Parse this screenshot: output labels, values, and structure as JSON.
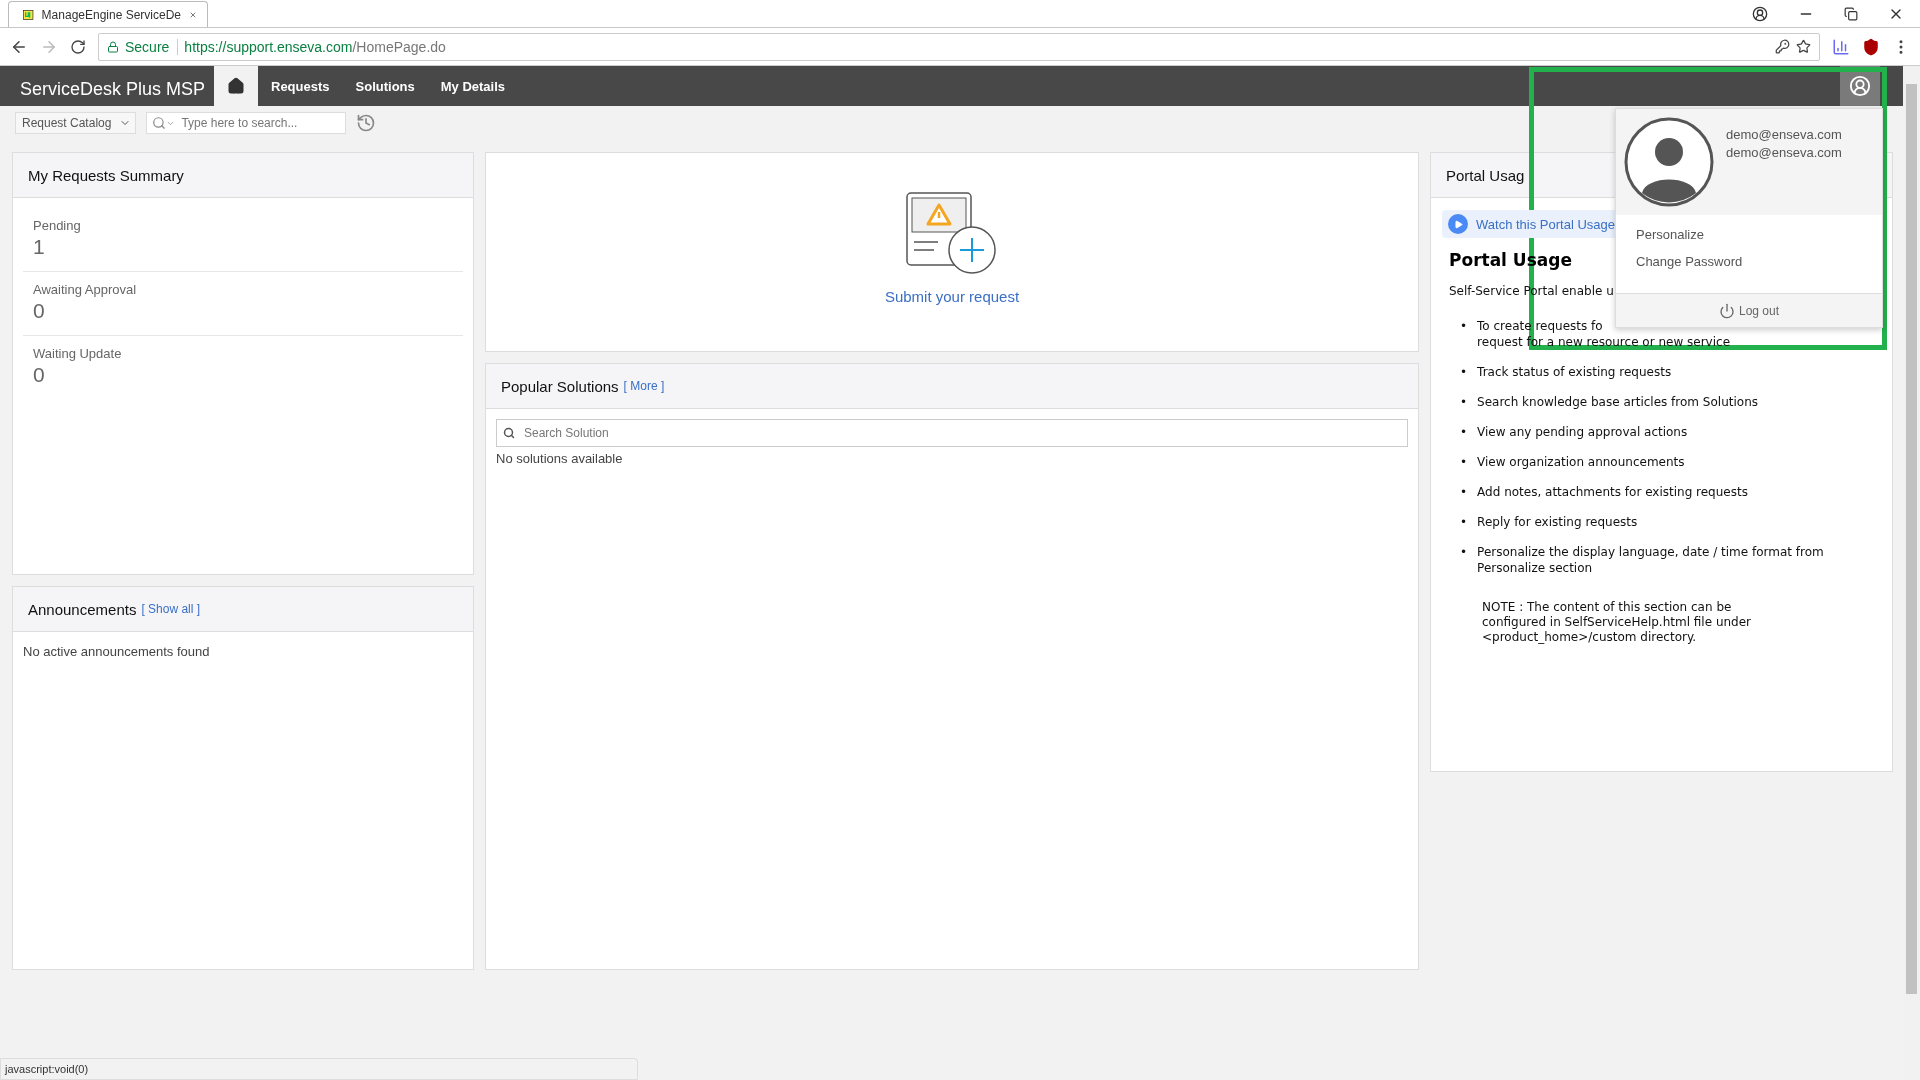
{
  "browser": {
    "tab_title": "ManageEngine ServiceDe",
    "secure_label": "Secure",
    "url_host": "https://support.enseva.com",
    "url_path": "/HomePage.do"
  },
  "nav": {
    "brand": "ServiceDesk Plus MSP",
    "items": [
      {
        "kind": "home",
        "selected": true
      },
      {
        "kind": "link",
        "label": "Requests",
        "selected": false
      },
      {
        "kind": "link",
        "label": "Solutions",
        "selected": false
      },
      {
        "kind": "link",
        "label": "My Details",
        "selected": false
      }
    ],
    "user_menu_open": true
  },
  "toolbar": {
    "catalog": "Request Catalog",
    "search_placeholder": "Type here to search..."
  },
  "summary": {
    "title": "My Requests Summary",
    "stats": [
      {
        "label": "Pending",
        "value": "1"
      },
      {
        "label": "Awaiting Approval",
        "value": "0"
      },
      {
        "label": "Waiting Update",
        "value": "0"
      }
    ]
  },
  "announcements": {
    "title": "Announcements",
    "link": "[ Show all ]",
    "empty": "No active announcements found"
  },
  "submit": {
    "label": "Submit your request"
  },
  "solutions": {
    "title": "Popular Solutions",
    "link": "[ More ]",
    "search_placeholder": "Search Solution",
    "empty": "No solutions available"
  },
  "portal": {
    "marker": "•",
    "title": "Portal Usag",
    "video_link": "Watch this Portal Usage",
    "heading": "Portal Usage",
    "intro": "Self-Service Portal enable u",
    "bullets": [
      {
        "lines": [
          "To create requests fo",
          "request for a new resource or new service"
        ]
      },
      {
        "lines": [
          "Track status of existing requests"
        ]
      },
      {
        "lines": [
          "Search knowledge base articles from Solutions"
        ]
      },
      {
        "lines": [
          "View any pending approval actions"
        ]
      },
      {
        "lines": [
          "View organization announcements"
        ]
      },
      {
        "lines": [
          "Add notes, attachments for existing requests"
        ]
      },
      {
        "lines": [
          "Reply for existing requests"
        ]
      },
      {
        "lines": [
          "Personalize the display language, date / time format from Personalize section"
        ]
      }
    ],
    "note": "NOTE : The content of this section can be configured in SelfServiceHelp.html file under <product_home>/custom directory."
  },
  "user_menu": {
    "emails": [
      "demo@enseva.com",
      "demo@enseva.com"
    ],
    "items": [
      "Personalize",
      "Change Password"
    ],
    "logout": "Log out"
  },
  "status_bar": "javascript:void(0)"
}
